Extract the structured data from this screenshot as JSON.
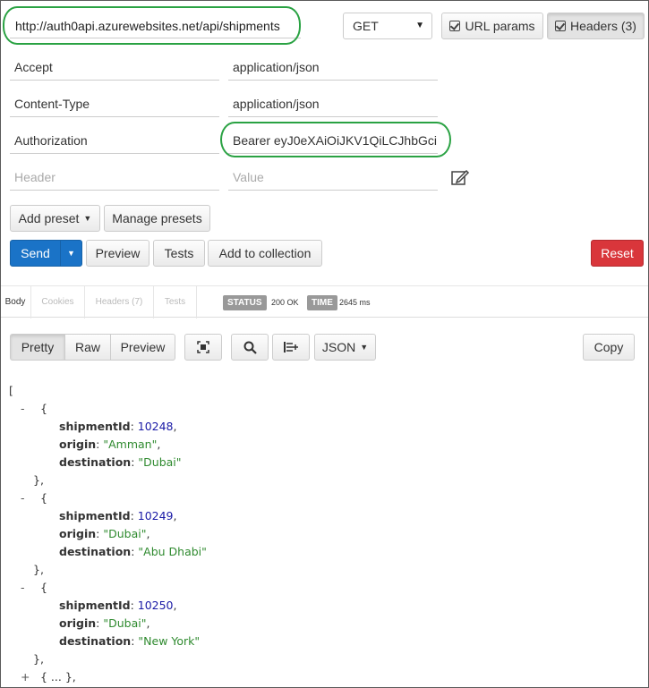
{
  "request": {
    "url": "http://auth0api.azurewebsites.net/api/shipments",
    "method": "GET",
    "url_params_label": "URL params",
    "headers_label": "Headers (3)"
  },
  "headers": [
    {
      "key": "Accept",
      "value": "application/json"
    },
    {
      "key": "Content-Type",
      "value": "application/json"
    },
    {
      "key": "Authorization",
      "value": "Bearer eyJ0eXAiOiJKV1QiLCJhbGci"
    }
  ],
  "new_header": {
    "key_placeholder": "Header",
    "value_placeholder": "Value"
  },
  "presets": {
    "add_label": "Add preset",
    "manage_label": "Manage presets"
  },
  "actions": {
    "send": "Send",
    "preview": "Preview",
    "tests": "Tests",
    "add_to_collection": "Add to collection",
    "reset": "Reset"
  },
  "response_tabs": [
    "Body",
    "Cookies",
    "Headers (7)",
    "Tests"
  ],
  "status": {
    "status_label": "STATUS",
    "status_value": "200 OK",
    "time_label": "TIME",
    "time_value": "2645 ms"
  },
  "view_modes": [
    "Pretty",
    "Raw",
    "Preview"
  ],
  "format_label": "JSON",
  "copy_label": "Copy",
  "colors": {
    "send": "#1a73c7",
    "reset": "#d9363b",
    "oval": "#2aa243"
  },
  "json_body": {
    "open": "[",
    "items": [
      {
        "shipmentId": "10248",
        "origin": "\"Amman\"",
        "destination": "\"Dubai\""
      },
      {
        "shipmentId": "10249",
        "origin": "\"Dubai\"",
        "destination": "\"Abu Dhabi\""
      },
      {
        "shipmentId": "10250",
        "origin": "\"Dubai\"",
        "destination": "\"New York\""
      }
    ],
    "collapsed": "{ ... },"
  }
}
